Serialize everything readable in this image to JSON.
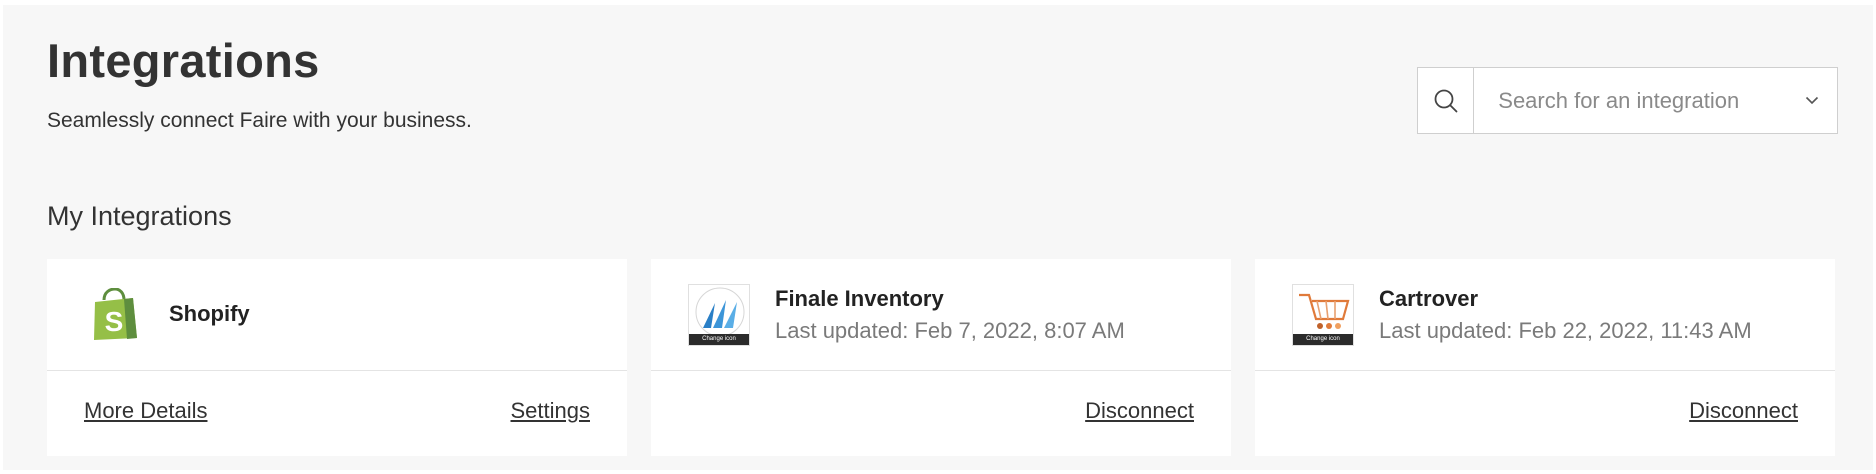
{
  "header": {
    "title": "Integrations",
    "subtitle": "Seamlessly connect Faire with your business."
  },
  "search": {
    "placeholder": "Search for an integration",
    "icon": "search-icon",
    "dropdown_icon": "chevron-down-icon"
  },
  "section": {
    "title": "My Integrations"
  },
  "integrations": [
    {
      "name": "Shopify",
      "icon": "shopify-logo-icon",
      "actions": {
        "more_details": "More Details",
        "settings": "Settings"
      }
    },
    {
      "name": "Finale Inventory",
      "last_updated": "Last updated: Feb 7, 2022, 8:07 AM",
      "icon": "finale-inventory-logo-icon",
      "icon_caption": "Change icon",
      "actions": {
        "disconnect": "Disconnect"
      }
    },
    {
      "name": "Cartrover",
      "last_updated": "Last updated: Feb 22, 2022, 11:43 AM",
      "icon": "cartrover-logo-icon",
      "icon_caption": "Change icon",
      "actions": {
        "disconnect": "Disconnect"
      }
    }
  ],
  "colors": {
    "background": "#f7f7f7",
    "card": "#ffffff",
    "text": "#333333",
    "muted": "#7a7a7a",
    "shopify_green": "#95bf47",
    "finale_blue": "#2a7fc6",
    "cartrover_orange": "#e07a3a"
  }
}
